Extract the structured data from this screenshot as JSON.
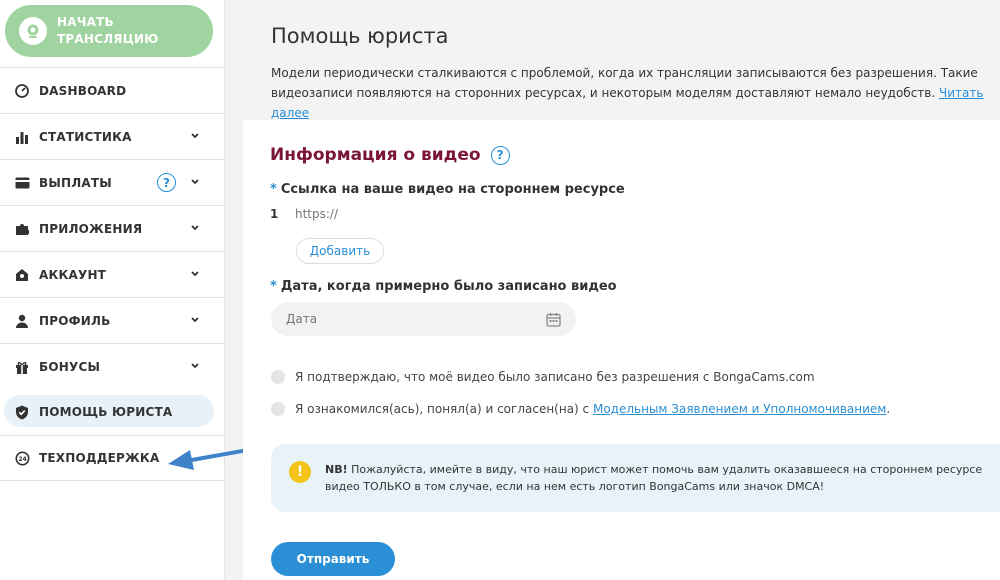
{
  "sidebar": {
    "start_button": "Начать\nтрансляцию",
    "items": [
      {
        "label": "DASHBOARD",
        "icon": "dashboard-icon"
      },
      {
        "label": "СТАТИСТИКА",
        "icon": "bar-chart-icon"
      },
      {
        "label": "ВЫПЛАТЫ",
        "icon": "credit-card-icon"
      },
      {
        "label": "ПРИЛОЖЕНИЯ",
        "icon": "puzzle-icon"
      },
      {
        "label": "АККАУНТ",
        "icon": "account-icon"
      },
      {
        "label": "ПРОФИЛЬ",
        "icon": "user-icon"
      },
      {
        "label": "БОНУСЫ",
        "icon": "gift-icon"
      },
      {
        "label": "ПОМОЩЬ ЮРИСТА",
        "icon": "shield-icon"
      },
      {
        "label": "ТЕХПОДДЕРЖКА",
        "icon": "support-icon"
      }
    ],
    "help_mark": "?"
  },
  "main": {
    "title": "Помощь юриста",
    "intro_text": "Модели периодически сталкиваются с проблемой, когда их трансляции записываются без разрешения. Такие видеозаписи появляются на сторонних ресурсах, и некоторым моделям доставляют немало неудобств.",
    "intro_link": "Читать далее",
    "section_title": "Информация о видео",
    "section_help": "?",
    "field_link_label": "Ссылка на ваше видео на стороннем ресурсе",
    "required_mark": "*",
    "link_row_number": "1",
    "link_placeholder": "https://",
    "add_button": "Добавить",
    "field_date_label": "Дата, когда примерно было записано видео",
    "date_placeholder": "Дата",
    "confirm_text": "Я подтверждаю, что моё видео было записано без разрешения с BongaCams.com",
    "agree_text": "Я ознакомился(ась), понял(а) и согласен(на) с",
    "agree_link": "Модельным Заявлением и Уполномочиванием",
    "agree_tail": ".",
    "notice_bold": "NB!",
    "notice_text": " Пожалуйста, имейте в виду, что наш юрист может помочь вам удалить оказавшееся на стороннем ресурсе видео ТОЛЬКО в том случае, если на нем есть логотип BongaCams или значок DMCA!",
    "submit_button": "Отправить"
  },
  "colors": {
    "accent": "#2b8fd6",
    "start_green": "#9fd39f",
    "section_title": "#7a1538",
    "warning": "#f6c417"
  }
}
